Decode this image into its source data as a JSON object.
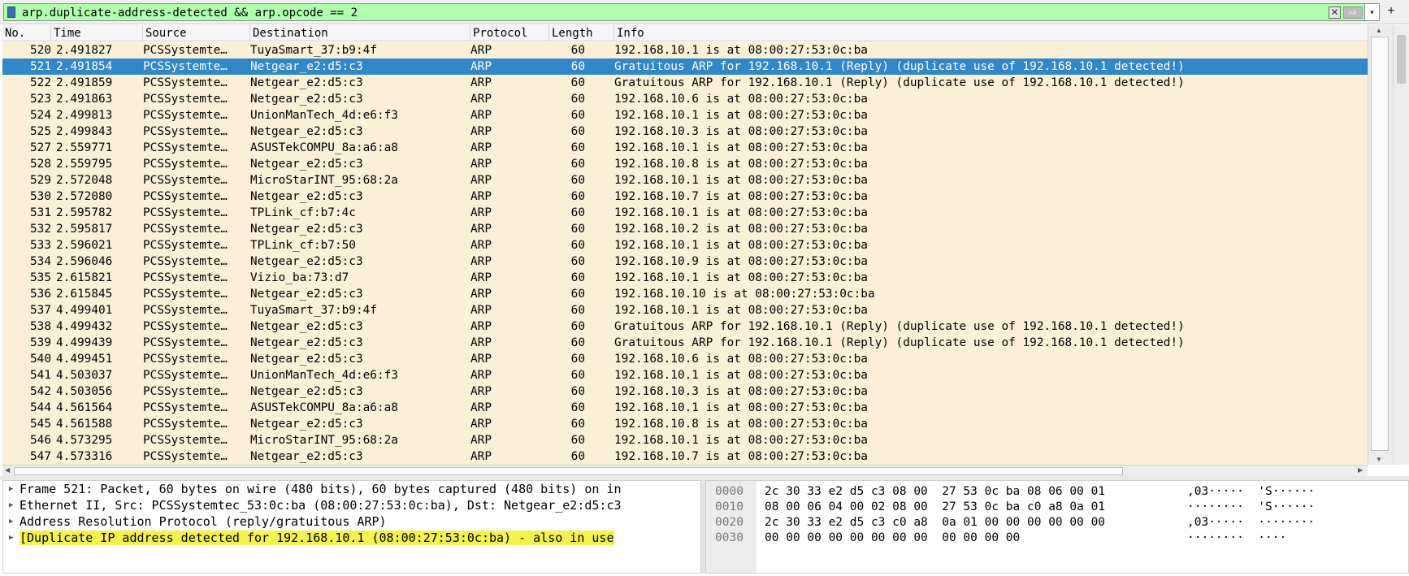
{
  "filter": {
    "expression": "arp.duplicate-address-detected && arp.opcode == 2",
    "clear_icon": "✕",
    "apply_icon": "⇨",
    "dropdown_icon": "▾",
    "add_icon": "+"
  },
  "columns": [
    "No.",
    "Time",
    "Source",
    "Destination",
    "Protocol",
    "Length",
    "Info"
  ],
  "packets": [
    {
      "no": "520",
      "time": "2.491827",
      "src": "PCSSystemte…",
      "dst": "TuyaSmart_37:b9:4f",
      "proto": "ARP",
      "len": "60",
      "info": "192.168.10.1 is at 08:00:27:53:0c:ba",
      "selected": false
    },
    {
      "no": "521",
      "time": "2.491854",
      "src": "PCSSystemte…",
      "dst": "Netgear_e2:d5:c3",
      "proto": "ARP",
      "len": "60",
      "info": "Gratuitous ARP for 192.168.10.1 (Reply) (duplicate use of 192.168.10.1 detected!)",
      "selected": true
    },
    {
      "no": "522",
      "time": "2.491859",
      "src": "PCSSystemte…",
      "dst": "Netgear_e2:d5:c3",
      "proto": "ARP",
      "len": "60",
      "info": "Gratuitous ARP for 192.168.10.1 (Reply) (duplicate use of 192.168.10.1 detected!)",
      "selected": false
    },
    {
      "no": "523",
      "time": "2.491863",
      "src": "PCSSystemte…",
      "dst": "Netgear_e2:d5:c3",
      "proto": "ARP",
      "len": "60",
      "info": "192.168.10.6 is at 08:00:27:53:0c:ba",
      "selected": false
    },
    {
      "no": "524",
      "time": "2.499813",
      "src": "PCSSystemte…",
      "dst": "UnionManTech_4d:e6:f3",
      "proto": "ARP",
      "len": "60",
      "info": "192.168.10.1 is at 08:00:27:53:0c:ba",
      "selected": false
    },
    {
      "no": "525",
      "time": "2.499843",
      "src": "PCSSystemte…",
      "dst": "Netgear_e2:d5:c3",
      "proto": "ARP",
      "len": "60",
      "info": "192.168.10.3 is at 08:00:27:53:0c:ba",
      "selected": false
    },
    {
      "no": "527",
      "time": "2.559771",
      "src": "PCSSystemte…",
      "dst": "ASUSTekCOMPU_8a:a6:a8",
      "proto": "ARP",
      "len": "60",
      "info": "192.168.10.1 is at 08:00:27:53:0c:ba",
      "selected": false
    },
    {
      "no": "528",
      "time": "2.559795",
      "src": "PCSSystemte…",
      "dst": "Netgear_e2:d5:c3",
      "proto": "ARP",
      "len": "60",
      "info": "192.168.10.8 is at 08:00:27:53:0c:ba",
      "selected": false
    },
    {
      "no": "529",
      "time": "2.572048",
      "src": "PCSSystemte…",
      "dst": "MicroStarINT_95:68:2a",
      "proto": "ARP",
      "len": "60",
      "info": "192.168.10.1 is at 08:00:27:53:0c:ba",
      "selected": false
    },
    {
      "no": "530",
      "time": "2.572080",
      "src": "PCSSystemte…",
      "dst": "Netgear_e2:d5:c3",
      "proto": "ARP",
      "len": "60",
      "info": "192.168.10.7 is at 08:00:27:53:0c:ba",
      "selected": false
    },
    {
      "no": "531",
      "time": "2.595782",
      "src": "PCSSystemte…",
      "dst": "TPLink_cf:b7:4c",
      "proto": "ARP",
      "len": "60",
      "info": "192.168.10.1 is at 08:00:27:53:0c:ba",
      "selected": false
    },
    {
      "no": "532",
      "time": "2.595817",
      "src": "PCSSystemte…",
      "dst": "Netgear_e2:d5:c3",
      "proto": "ARP",
      "len": "60",
      "info": "192.168.10.2 is at 08:00:27:53:0c:ba",
      "selected": false
    },
    {
      "no": "533",
      "time": "2.596021",
      "src": "PCSSystemte…",
      "dst": "TPLink_cf:b7:50",
      "proto": "ARP",
      "len": "60",
      "info": "192.168.10.1 is at 08:00:27:53:0c:ba",
      "selected": false
    },
    {
      "no": "534",
      "time": "2.596046",
      "src": "PCSSystemte…",
      "dst": "Netgear_e2:d5:c3",
      "proto": "ARP",
      "len": "60",
      "info": "192.168.10.9 is at 08:00:27:53:0c:ba",
      "selected": false
    },
    {
      "no": "535",
      "time": "2.615821",
      "src": "PCSSystemte…",
      "dst": "Vizio_ba:73:d7",
      "proto": "ARP",
      "len": "60",
      "info": "192.168.10.1 is at 08:00:27:53:0c:ba",
      "selected": false
    },
    {
      "no": "536",
      "time": "2.615845",
      "src": "PCSSystemte…",
      "dst": "Netgear_e2:d5:c3",
      "proto": "ARP",
      "len": "60",
      "info": "192.168.10.10 is at 08:00:27:53:0c:ba",
      "selected": false
    },
    {
      "no": "537",
      "time": "4.499401",
      "src": "PCSSystemte…",
      "dst": "TuyaSmart_37:b9:4f",
      "proto": "ARP",
      "len": "60",
      "info": "192.168.10.1 is at 08:00:27:53:0c:ba",
      "selected": false
    },
    {
      "no": "538",
      "time": "4.499432",
      "src": "PCSSystemte…",
      "dst": "Netgear_e2:d5:c3",
      "proto": "ARP",
      "len": "60",
      "info": "Gratuitous ARP for 192.168.10.1 (Reply) (duplicate use of 192.168.10.1 detected!)",
      "selected": false
    },
    {
      "no": "539",
      "time": "4.499439",
      "src": "PCSSystemte…",
      "dst": "Netgear_e2:d5:c3",
      "proto": "ARP",
      "len": "60",
      "info": "Gratuitous ARP for 192.168.10.1 (Reply) (duplicate use of 192.168.10.1 detected!)",
      "selected": false
    },
    {
      "no": "540",
      "time": "4.499451",
      "src": "PCSSystemte…",
      "dst": "Netgear_e2:d5:c3",
      "proto": "ARP",
      "len": "60",
      "info": "192.168.10.6 is at 08:00:27:53:0c:ba",
      "selected": false
    },
    {
      "no": "541",
      "time": "4.503037",
      "src": "PCSSystemte…",
      "dst": "UnionManTech_4d:e6:f3",
      "proto": "ARP",
      "len": "60",
      "info": "192.168.10.1 is at 08:00:27:53:0c:ba",
      "selected": false
    },
    {
      "no": "542",
      "time": "4.503056",
      "src": "PCSSystemte…",
      "dst": "Netgear_e2:d5:c3",
      "proto": "ARP",
      "len": "60",
      "info": "192.168.10.3 is at 08:00:27:53:0c:ba",
      "selected": false
    },
    {
      "no": "544",
      "time": "4.561564",
      "src": "PCSSystemte…",
      "dst": "ASUSTekCOMPU_8a:a6:a8",
      "proto": "ARP",
      "len": "60",
      "info": "192.168.10.1 is at 08:00:27:53:0c:ba",
      "selected": false
    },
    {
      "no": "545",
      "time": "4.561588",
      "src": "PCSSystemte…",
      "dst": "Netgear_e2:d5:c3",
      "proto": "ARP",
      "len": "60",
      "info": "192.168.10.8 is at 08:00:27:53:0c:ba",
      "selected": false
    },
    {
      "no": "546",
      "time": "4.573295",
      "src": "PCSSystemte…",
      "dst": "MicroStarINT_95:68:2a",
      "proto": "ARP",
      "len": "60",
      "info": "192.168.10.1 is at 08:00:27:53:0c:ba",
      "selected": false
    },
    {
      "no": "547",
      "time": "4.573316",
      "src": "PCSSystemte…",
      "dst": "Netgear_e2:d5:c3",
      "proto": "ARP",
      "len": "60",
      "info": "192.168.10.7 is at 08:00:27:53:0c:ba",
      "selected": false
    }
  ],
  "details": [
    {
      "text": "Frame 521: Packet, 60 bytes on wire (480 bits), 60 bytes captured (480 bits) on in",
      "warn": false
    },
    {
      "text": "Ethernet II, Src: PCSSystemtec_53:0c:ba (08:00:27:53:0c:ba), Dst: Netgear_e2:d5:c3",
      "warn": false
    },
    {
      "text": "Address Resolution Protocol (reply/gratuitous ARP)",
      "warn": false
    },
    {
      "text": "[Duplicate IP address detected for 192.168.10.1 (08:00:27:53:0c:ba) - also in use",
      "warn": true
    }
  ],
  "bytes": [
    {
      "offset": "0000",
      "hex": "2c 30 33 e2 d5 c3 08 00  27 53 0c ba 08 06 00 01",
      "ascii": ",03·····  'S······"
    },
    {
      "offset": "0010",
      "hex": "08 00 06 04 00 02 08 00  27 53 0c ba c0 a8 0a 01",
      "ascii": "········  'S······"
    },
    {
      "offset": "0020",
      "hex": "2c 30 33 e2 d5 c3 c0 a8  0a 01 00 00 00 00 00 00",
      "ascii": ",03·····  ········"
    },
    {
      "offset": "0030",
      "hex": "00 00 00 00 00 00 00 00  00 00 00 00",
      "ascii": "········  ····"
    }
  ],
  "colors": {
    "row_bg": "#faf0d7",
    "selected_bg": "#3187c7",
    "filter_valid_bg": "#afffaf",
    "warning_bg": "#f4f24f"
  }
}
